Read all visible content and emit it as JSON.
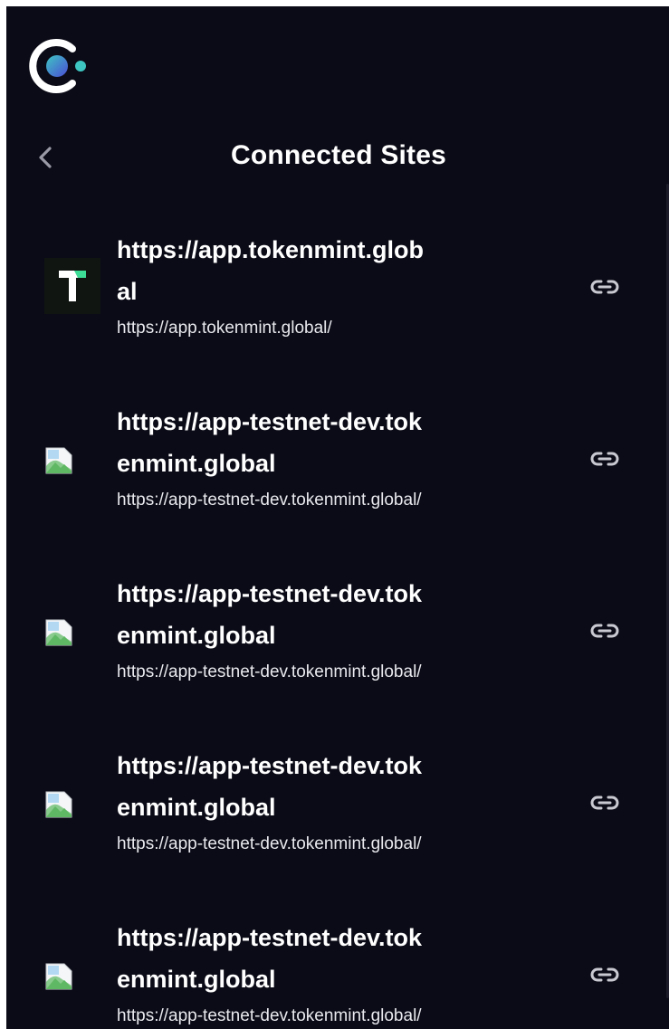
{
  "header": {
    "logo_icon": "brand-logo-icon",
    "back_icon": "chevron-left-icon",
    "title": "Connected Sites"
  },
  "sites": [
    {
      "name": "https://app.tokenmint.global",
      "url": "https://app.tokenmint.global/",
      "favicon": "tokenmint-logo-icon",
      "action_icon": "link-icon"
    },
    {
      "name": "https://app-testnet-dev.tokenmint.global",
      "url": "https://app-testnet-dev.tokenmint.global/",
      "favicon": "broken-image-icon",
      "action_icon": "link-icon"
    },
    {
      "name": "https://app-testnet-dev.tokenmint.global",
      "url": "https://app-testnet-dev.tokenmint.global/",
      "favicon": "broken-image-icon",
      "action_icon": "link-icon"
    },
    {
      "name": "https://app-testnet-dev.tokenmint.global",
      "url": "https://app-testnet-dev.tokenmint.global/",
      "favicon": "broken-image-icon",
      "action_icon": "link-icon"
    },
    {
      "name": "https://app-testnet-dev.tokenmint.global",
      "url": "https://app-testnet-dev.tokenmint.global/",
      "favicon": "broken-image-icon",
      "action_icon": "link-icon"
    }
  ],
  "colors": {
    "background": "#0b0b17",
    "text": "#ffffff",
    "link_icon": "#c9c9d2",
    "logo_gradient_start": "#3ec6c2",
    "logo_gradient_end": "#4a4cd6",
    "tokenmint_green": "#3ddc97"
  }
}
